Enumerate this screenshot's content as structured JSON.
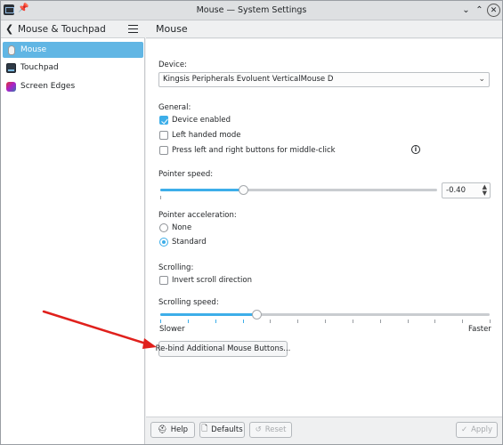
{
  "window": {
    "title": "Mouse — System Settings"
  },
  "sidebar": {
    "header": "Mouse & Touchpad",
    "items": [
      {
        "label": "Mouse",
        "icon": "mouse-icon",
        "active": true
      },
      {
        "label": "Touchpad",
        "icon": "touchpad-icon",
        "active": false
      },
      {
        "label": "Screen Edges",
        "icon": "screen-edges-icon",
        "active": false
      }
    ]
  },
  "main": {
    "title": "Mouse",
    "device_label": "Device:",
    "device_value": "Kingsis Peripherals Evoluent VerticalMouse D",
    "general_label": "General:",
    "device_enabled": "Device enabled",
    "left_handed": "Left handed mode",
    "middle_click": "Press left and right buttons for middle-click",
    "pointer_speed_label": "Pointer speed:",
    "pointer_speed_value": "-0.40",
    "pointer_speed_level": 0.3,
    "pointer_accel_label": "Pointer acceleration:",
    "accel_none": "None",
    "accel_standard": "Standard",
    "scrolling_label": "Scrolling:",
    "invert_scroll": "Invert scroll direction",
    "scrolling_speed_label": "Scrolling speed:",
    "scrolling_speed_level": 0.293,
    "slower": "Slower",
    "faster": "Faster",
    "rebind_button": "Re-bind Additional Mouse Buttons..."
  },
  "footer": {
    "help": "Help",
    "defaults": "Defaults",
    "reset": "Reset",
    "apply": "Apply"
  },
  "colors": {
    "accent": "#3daee9",
    "annotation_arrow": "#e0201c"
  }
}
